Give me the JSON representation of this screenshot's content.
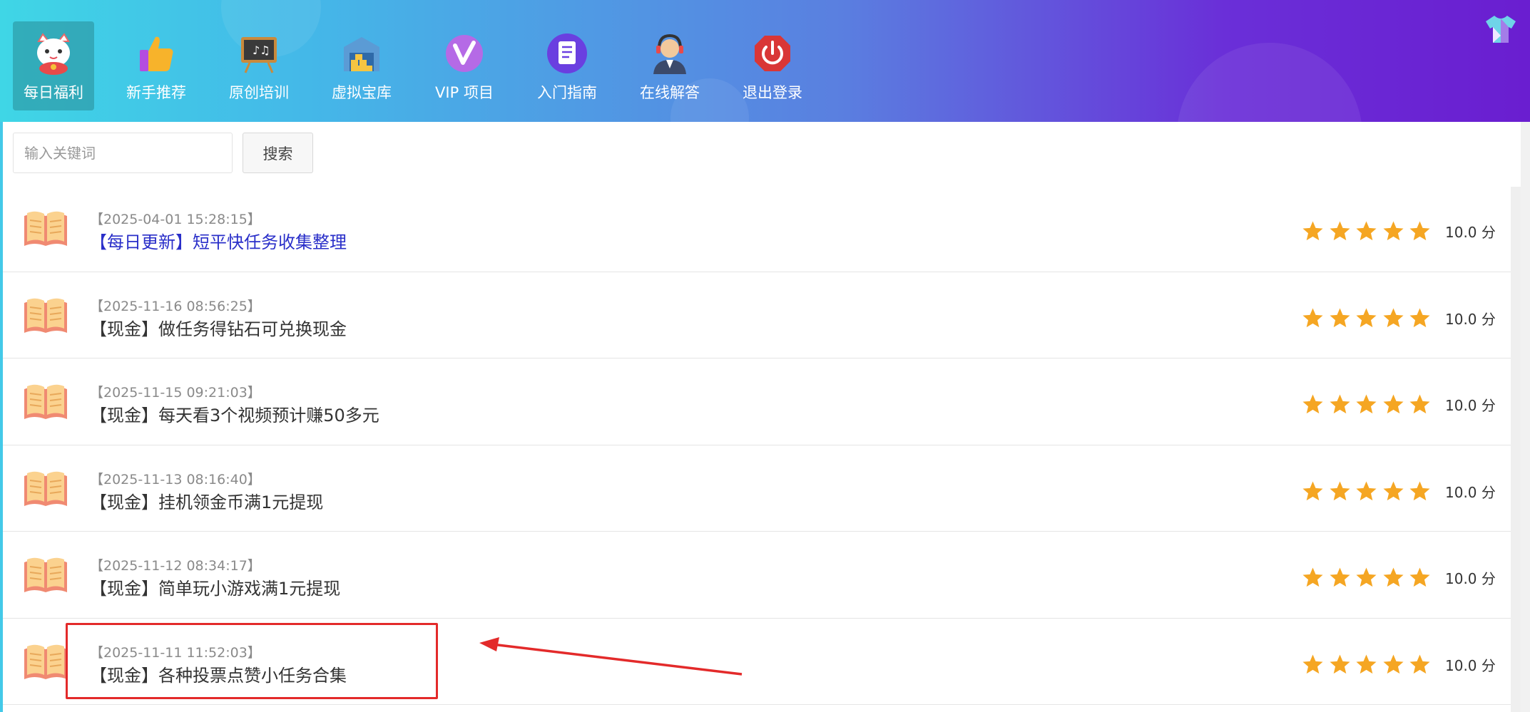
{
  "nav": {
    "items": [
      {
        "label": "每日福利",
        "icon": "lucky-cat-icon",
        "active": true
      },
      {
        "label": "新手推荐",
        "icon": "thumbs-up-icon",
        "active": false
      },
      {
        "label": "原创培训",
        "icon": "chalkboard-icon",
        "active": false
      },
      {
        "label": "虚拟宝库",
        "icon": "warehouse-icon",
        "active": false
      },
      {
        "label": "VIP 项目",
        "icon": "vip-icon",
        "active": false
      },
      {
        "label": "入门指南",
        "icon": "document-icon",
        "active": false
      },
      {
        "label": "在线解答",
        "icon": "support-agent-icon",
        "active": false
      },
      {
        "label": "退出登录",
        "icon": "power-icon",
        "active": false
      }
    ]
  },
  "search": {
    "placeholder": "输入关键词",
    "value": "",
    "button_label": "搜索"
  },
  "colors": {
    "accent_link": "#2a2fc9",
    "star": "#f5a623",
    "annotation": "#e32a2a"
  },
  "list": {
    "items": [
      {
        "date": "【2025-04-01 15:28:15】",
        "title": "【每日更新】短平快任务收集整理",
        "rating": 5,
        "score": "10.0 分",
        "highlight": true
      },
      {
        "date": "【2025-11-16 08:56:25】",
        "title": "【现金】做任务得钻石可兑换现金",
        "rating": 5,
        "score": "10.0 分",
        "highlight": false
      },
      {
        "date": "【2025-11-15 09:21:03】",
        "title": "【现金】每天看3个视频预计赚50多元",
        "rating": 5,
        "score": "10.0 分",
        "highlight": false
      },
      {
        "date": "【2025-11-13 08:16:40】",
        "title": "【现金】挂机领金币满1元提现",
        "rating": 5,
        "score": "10.0 分",
        "highlight": false
      },
      {
        "date": "【2025-11-12 08:34:17】",
        "title": "【现金】简单玩小游戏满1元提现",
        "rating": 5,
        "score": "10.0 分",
        "highlight": false
      },
      {
        "date": "【2025-11-11 11:52:03】",
        "title": "【现金】各种投票点赞小任务合集",
        "rating": 5,
        "score": "10.0 分",
        "highlight": false
      }
    ]
  }
}
